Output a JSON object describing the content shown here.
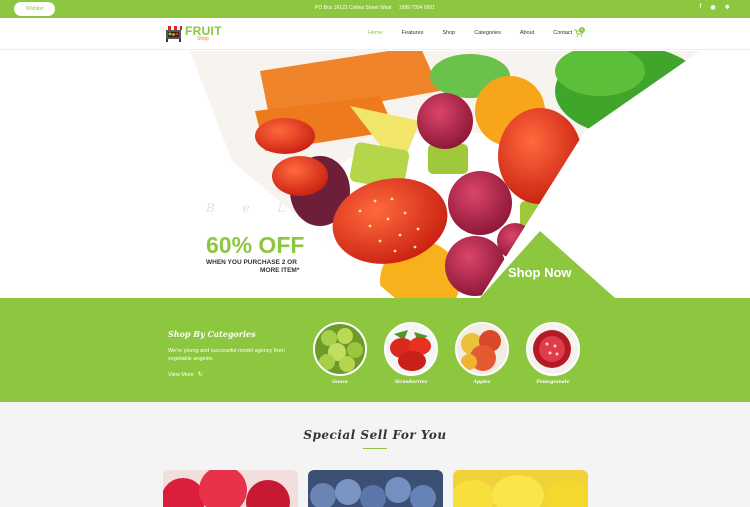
{
  "topbar": {
    "wishlist_label": "Wishlist",
    "address": "PO Box 16122 Collins Street West",
    "phone": "1989 7994 0901",
    "social_icons": [
      "facebook-icon",
      "instagram-icon",
      "twitter-icon"
    ]
  },
  "brand": {
    "name": "FRUIT",
    "tagline": "Shop",
    "colors": {
      "accent": "#8dc63f",
      "orange": "#f58220",
      "dark": "#333333"
    }
  },
  "nav": {
    "items": [
      {
        "label": "Home",
        "active": true
      },
      {
        "label": "Features",
        "active": false
      },
      {
        "label": "Shop",
        "active": false
      },
      {
        "label": "Categories",
        "active": false
      },
      {
        "label": "About",
        "active": false
      },
      {
        "label": "Contact",
        "active": false
      }
    ],
    "cart_count": "0"
  },
  "hero": {
    "script_text": "B  e  L",
    "discount": "60% OFF",
    "offer_line1": "WHEN YOU PURCHASE 2 OR",
    "offer_line2": "MORE ITEM*",
    "cta_label": "Shop Now"
  },
  "categories": {
    "heading": "Shop By Categories",
    "description": "We're young and successful model agency from vegetable angeles",
    "view_more_label": "View More",
    "items": [
      {
        "label": "Guava"
      },
      {
        "label": "Strawberries"
      },
      {
        "label": "Apples"
      },
      {
        "label": "Pomegranate"
      }
    ]
  },
  "special": {
    "title": "Special Sell For You"
  }
}
